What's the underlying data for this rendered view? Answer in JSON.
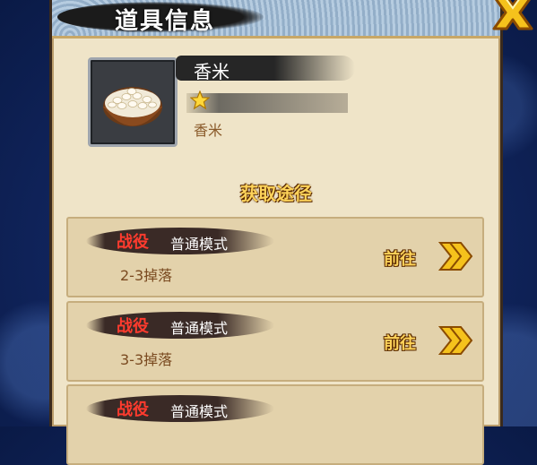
{
  "dialog": {
    "title": "道具信息"
  },
  "item": {
    "name": "香米",
    "stars": 1,
    "description": "香米"
  },
  "section": {
    "title": "获取途径"
  },
  "sources": [
    {
      "type": "战役",
      "mode": "普通模式",
      "drop": "2-3掉落",
      "go_label": "前往"
    },
    {
      "type": "战役",
      "mode": "普通模式",
      "drop": "3-3掉落",
      "go_label": "前往"
    },
    {
      "type": "战役",
      "mode": "普通模式",
      "drop": "",
      "go_label": ""
    }
  ],
  "colors": {
    "panel_bg": "#efe4c8",
    "title_text": "#ffffff",
    "section_title": "#fdd35a",
    "source_type": "#ff3b2e",
    "drop_text": "#7a4a20"
  },
  "icons": {
    "close": "close-x-icon",
    "star": "star-icon",
    "go_arrow": "double-chevron-right-icon",
    "item": "rice-bowl-icon"
  }
}
